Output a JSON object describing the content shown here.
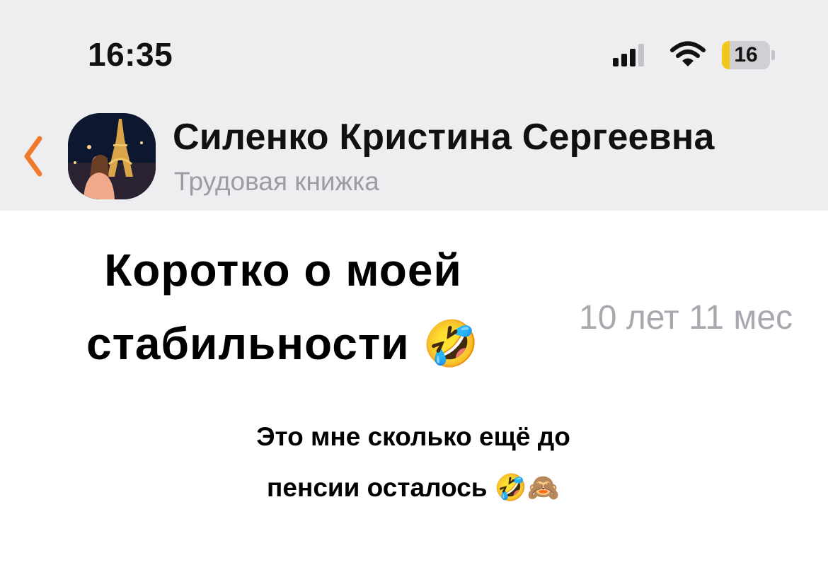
{
  "status_bar": {
    "time": "16:35",
    "battery_level": "16",
    "battery_percent": 16,
    "battery_color": "#f2c81c",
    "icons": [
      "signal-icon",
      "wifi-icon",
      "battery-icon"
    ]
  },
  "header": {
    "back_icon": "chevron-left-icon",
    "back_color": "#f07a2c",
    "name": "Силенко Кристина Сергеевна",
    "subtitle": "Трудовая книжка"
  },
  "post": {
    "headline_line1": "Коротко о моей",
    "headline_line2": "стабильности 🤣",
    "duration": "10 лет 11 мес",
    "caption_line1": "Это мне сколько ещё до",
    "caption_line2": "пенсии осталось 🤣🙈"
  }
}
